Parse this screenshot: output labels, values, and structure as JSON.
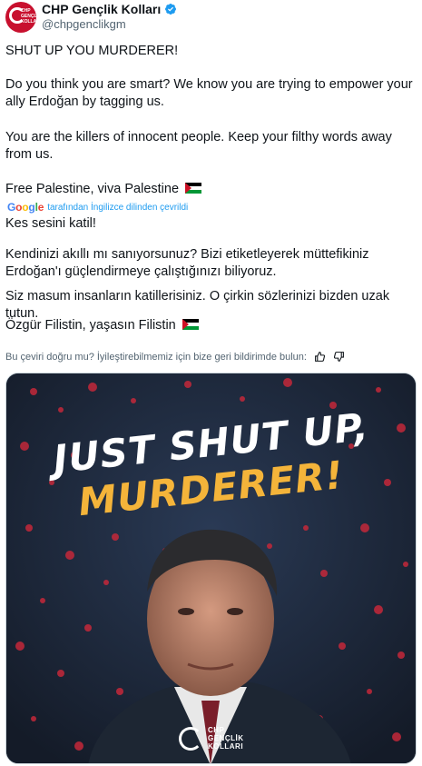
{
  "author": {
    "name": "CHP Gençlik Kolları",
    "handle": "@chpgenclikgm",
    "avatar_text": "CHP GENÇLİK KOLLARI",
    "verified_icon": "verified-badge-icon"
  },
  "tweet": {
    "original": {
      "line1": "SHUT UP YOU MURDERER!",
      "line2": "Do you think you are smart? We know you are trying to empower your ally Erdoğan by tagging us.",
      "line3": "You are the killers of innocent people. Keep your filthy words away from us.",
      "line4": "Free Palestine, viva Palestine"
    },
    "translation_note": {
      "brand": "Google",
      "text": "tarafından İngilizce dilinden çevrildi"
    },
    "translated": {
      "line1": "Kes sesini katil!",
      "line2": "Kendinizi akıllı mı sanıyorsunuz? Bizi etiketleyerek müttefikiniz Erdoğan'ı güçlendirmeye çalıştığınızı biliyoruz.",
      "line3": "Siz masum insanların katillerisiniz. O çirkin sözlerinizi bizden uzak tutun.",
      "line4": "Özgür Filistin, yaşasın Filistin"
    },
    "feedback_prompt": "Bu çeviri doğru mu? İyileştirebilmemiz için bize geri bildirimde bulun:"
  },
  "media": {
    "headline_line1": "JUST SHUT UP,",
    "headline_line2": "MURDERER!",
    "brand_text": "CHP GENÇLİK KOLLARI"
  },
  "colors": {
    "brand_red": "#c8102e",
    "link_blue": "#1d9bf0",
    "poster_accent": "#f4b43a"
  }
}
